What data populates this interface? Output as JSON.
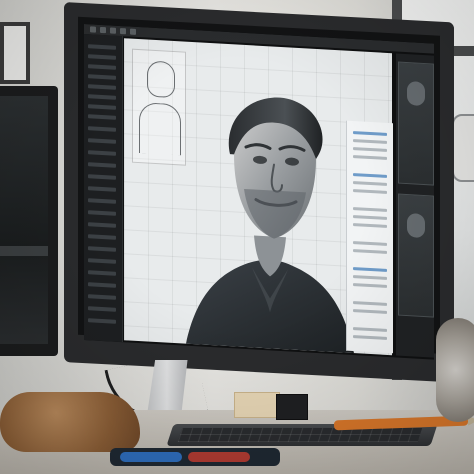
{
  "scene": {
    "description_free": true
  },
  "palette": {
    "wall": "#e7e6e2",
    "monitor_bezel": "#2a2b2d",
    "screen_bg": "#0f1011",
    "canvas_bg": "#e8ebec",
    "accent_blue": "#6f9cc9",
    "pencil_orange": "#d9772a",
    "marker_blue": "#2f6fbf",
    "marker_red": "#b23c33"
  },
  "icons": {
    "webcam": "webcam-icon"
  }
}
